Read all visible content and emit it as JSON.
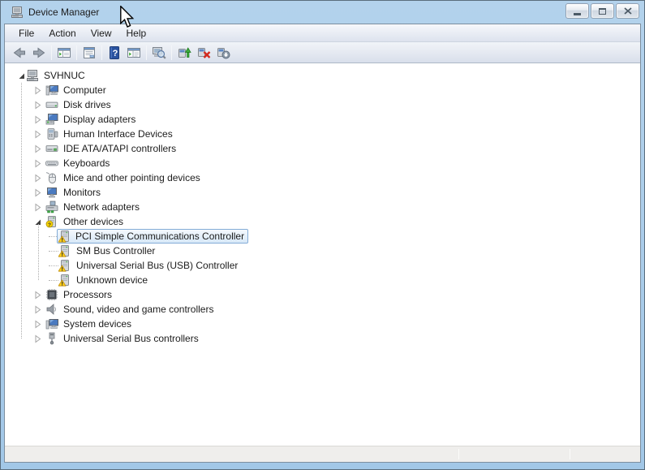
{
  "window": {
    "title": "Device Manager",
    "controls": [
      {
        "name": "minimize"
      },
      {
        "name": "maximize"
      },
      {
        "name": "close"
      }
    ]
  },
  "menu": {
    "items": [
      "File",
      "Action",
      "View",
      "Help"
    ]
  },
  "toolbar": {
    "icons": [
      "back",
      "forward",
      "show-console-tree",
      "properties",
      "help",
      "show-action-pane",
      "scan-for-hardware-changes",
      "update-driver",
      "uninstall",
      "disable"
    ]
  },
  "tree": {
    "items": [
      {
        "label": "SVHNUC",
        "depth": 0,
        "expander": "expanded",
        "icon": "computer-root-icon",
        "selected": false
      },
      {
        "label": "Computer",
        "depth": 1,
        "expander": "collapsed",
        "icon": "computer-icon",
        "selected": false
      },
      {
        "label": "Disk drives",
        "depth": 1,
        "expander": "collapsed",
        "icon": "disk-drive-icon",
        "selected": false
      },
      {
        "label": "Display adapters",
        "depth": 1,
        "expander": "collapsed",
        "icon": "display-adapter-icon",
        "selected": false
      },
      {
        "label": "Human Interface Devices",
        "depth": 1,
        "expander": "collapsed",
        "icon": "hid-icon",
        "selected": false
      },
      {
        "label": "IDE ATA/ATAPI controllers",
        "depth": 1,
        "expander": "collapsed",
        "icon": "ide-controller-icon",
        "selected": false
      },
      {
        "label": "Keyboards",
        "depth": 1,
        "expander": "collapsed",
        "icon": "keyboard-icon",
        "selected": false
      },
      {
        "label": "Mice and other pointing devices",
        "depth": 1,
        "expander": "collapsed",
        "icon": "mouse-icon",
        "selected": false
      },
      {
        "label": "Monitors",
        "depth": 1,
        "expander": "collapsed",
        "icon": "monitor-icon",
        "selected": false
      },
      {
        "label": "Network adapters",
        "depth": 1,
        "expander": "collapsed",
        "icon": "network-adapter-icon",
        "selected": false
      },
      {
        "label": "Other devices",
        "depth": 1,
        "expander": "expanded",
        "icon": "unknown-device-icon",
        "selected": false
      },
      {
        "label": "PCI Simple Communications Controller",
        "depth": 2,
        "expander": "none",
        "icon": "warning-device-icon",
        "selected": true
      },
      {
        "label": "SM Bus Controller",
        "depth": 2,
        "expander": "none",
        "icon": "warning-device-icon",
        "selected": false
      },
      {
        "label": "Universal Serial Bus (USB) Controller",
        "depth": 2,
        "expander": "none",
        "icon": "warning-device-icon",
        "selected": false
      },
      {
        "label": "Unknown device",
        "depth": 2,
        "expander": "none",
        "icon": "warning-device-icon",
        "selected": false
      },
      {
        "label": "Processors",
        "depth": 1,
        "expander": "collapsed",
        "icon": "processor-icon",
        "selected": false
      },
      {
        "label": "Sound, video and game controllers",
        "depth": 1,
        "expander": "collapsed",
        "icon": "speaker-icon",
        "selected": false
      },
      {
        "label": "System devices",
        "depth": 1,
        "expander": "collapsed",
        "icon": "system-device-icon",
        "selected": false
      },
      {
        "label": "Universal Serial Bus controllers",
        "depth": 1,
        "expander": "collapsed",
        "icon": "usb-icon",
        "selected": false
      }
    ]
  },
  "status_bar": {
    "panels": [
      "",
      "",
      ""
    ]
  },
  "colors": {
    "titlebar": "#a8cbe9",
    "frame": "#a6c9e8",
    "selection_border": "#84acd6",
    "selection_fill": "#d8e9f8",
    "warning_yellow": "#fdd017",
    "help_blue": "#2a53a0",
    "statusbar": "#efeeec"
  }
}
